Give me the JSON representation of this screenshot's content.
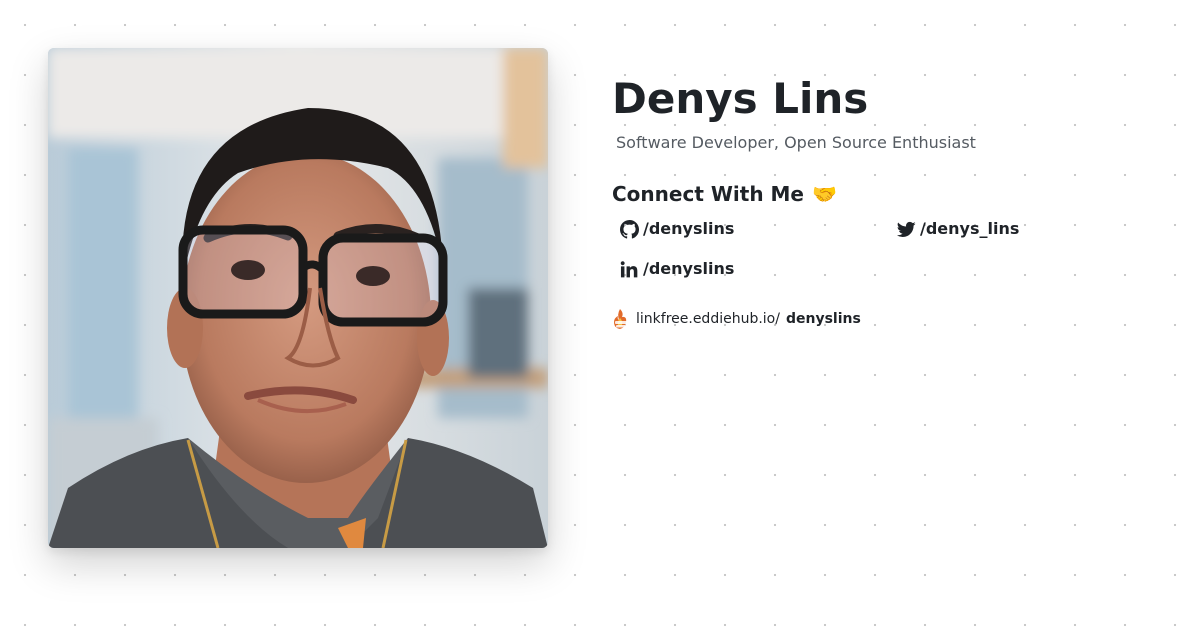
{
  "profile": {
    "name": "Denys Lins",
    "tagline": "Software Developer, Open Source Enthusiast",
    "photo_alt": "Denys Lins"
  },
  "connect": {
    "heading": "Connect With Me",
    "emoji": "🤝",
    "links": [
      {
        "icon": "github-icon",
        "label": "/denyslins"
      },
      {
        "icon": "twitter-icon",
        "label": "/denys_lins"
      },
      {
        "icon": "linkedin-icon",
        "label": "/denyslins"
      }
    ]
  },
  "footer": {
    "icon": "linkfree-logo-icon",
    "domain": "linkfree.eddiehub.io/",
    "username": "denyslins"
  }
}
